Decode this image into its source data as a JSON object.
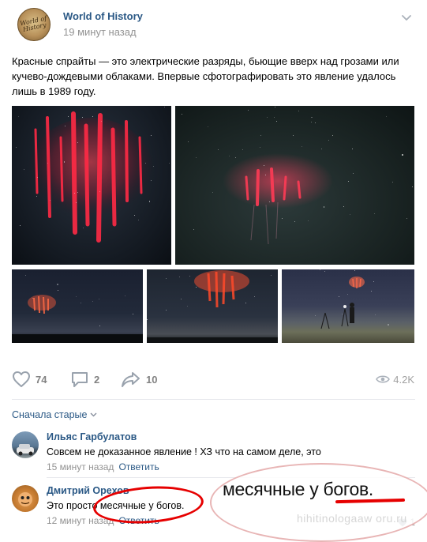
{
  "post": {
    "group_name": "World of History",
    "time": "19 минут назад",
    "logo_text": "World of History",
    "text": "Красные спрайты — это электрические разряды, бьющие вверх над грозами или кучево-дождевыми облаками. Впервые сфотографировать это явление удалось лишь в 1989 году."
  },
  "actions": {
    "likes": "74",
    "comments": "2",
    "shares": "10",
    "views": "4.2K"
  },
  "comments_section": {
    "sort_label": "Сначала старые",
    "comments": [
      {
        "author": "Ильяс Гарбулатов",
        "text": "Совсем не доказанное явление ! ХЗ что на самом деле, это",
        "time": "15 минут назад",
        "reply": "Ответить"
      },
      {
        "author": "Дмитрий Орехов",
        "text": "Это просто месячные у богов.",
        "time": "12 минут назад",
        "reply": "Ответить",
        "likes": "1"
      }
    ]
  },
  "overlay": {
    "zoom_text": "месячные у богов.",
    "watermark": "hihitinologaaw oru.ru"
  },
  "colors": {
    "link": "#2a5885",
    "muted": "#939393",
    "highlight_red": "#e60000"
  }
}
